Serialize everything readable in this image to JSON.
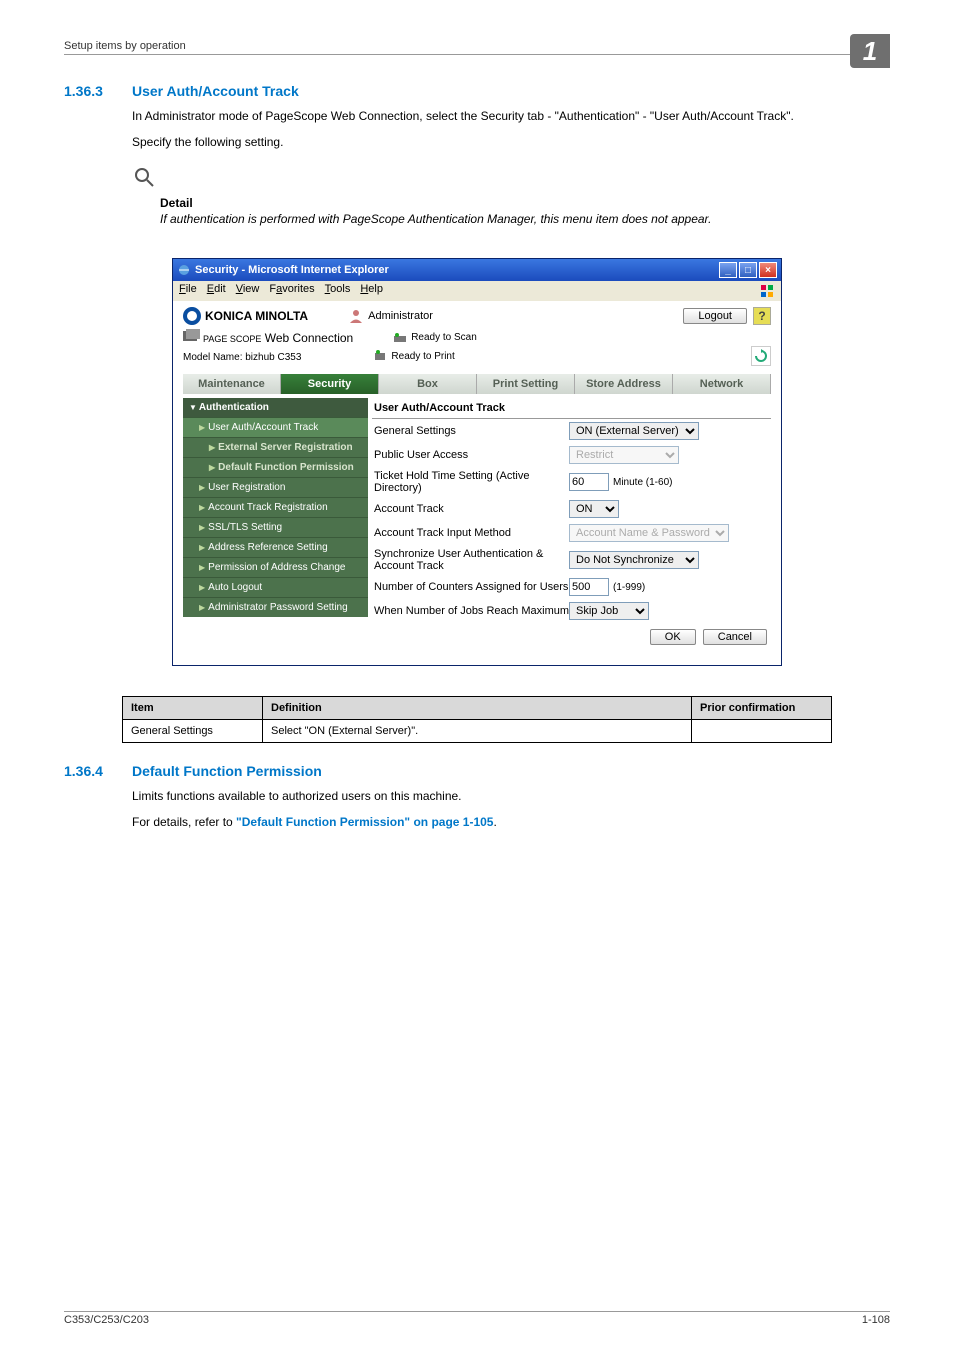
{
  "running_head": "Setup items by operation",
  "chapter_tab": "1",
  "section1": {
    "number": "1.36.3",
    "title": "User Auth/Account Track"
  },
  "intro1": "In Administrator mode of PageScope Web Connection, select the Security tab - \"Authentication\" - \"User Auth/Account Track\".",
  "intro2": "Specify the following setting.",
  "detail": {
    "label": "Detail",
    "text": "If authentication is performed with PageScope Authentication Manager, this menu item does not appear."
  },
  "browser": {
    "title": "Security - Microsoft Internet Explorer",
    "menus": [
      "File",
      "Edit",
      "View",
      "Favorites",
      "Tools",
      "Help"
    ]
  },
  "header": {
    "brand": "KONICA MINOLTA",
    "admin_label": "Administrator",
    "logout": "Logout",
    "product": "Web Connection",
    "product_prefix": "PAGE SCOPE",
    "status_scan": "Ready to Scan",
    "status_print": "Ready to Print",
    "model": "Model Name: bizhub C353"
  },
  "tabs": [
    "Maintenance",
    "Security",
    "Box",
    "Print Setting",
    "Store Address",
    "Network"
  ],
  "side": {
    "head": "Authentication",
    "items": [
      "User Auth/Account Track",
      "External Server Registration",
      "Default Function Permission",
      "User Registration",
      "Account Track Registration",
      "SSL/TLS Setting",
      "Address Reference Setting",
      "Permission of Address Change",
      "Auto Logout",
      "Administrator Password Setting"
    ]
  },
  "form": {
    "title": "User Auth/Account Track",
    "rows": {
      "general_settings": {
        "label": "General Settings",
        "value": "ON (External Server)"
      },
      "public_user": {
        "label": "Public User Access",
        "value": "Restrict"
      },
      "ticket": {
        "label": "Ticket Hold Time Setting (Active Directory)",
        "value": "60",
        "unit": "Minute (1-60)"
      },
      "account_track": {
        "label": "Account Track",
        "value": "ON"
      },
      "input_method": {
        "label": "Account Track Input Method",
        "value": "Account Name & Password"
      },
      "sync": {
        "label": "Synchronize User Authentication & Account Track",
        "value": "Do Not Synchronize"
      },
      "counters": {
        "label": "Number of Counters Assigned for Users",
        "value": "500",
        "unit": "(1-999)"
      },
      "maxjob": {
        "label": "When Number of Jobs Reach Maximum",
        "value": "Skip Job"
      }
    },
    "ok": "OK",
    "cancel": "Cancel"
  },
  "def_table": {
    "headers": {
      "item": "Item",
      "def": "Definition",
      "prior": "Prior confirmation"
    },
    "row1": {
      "item": "General Settings",
      "def": "Select \"ON (External Server)\".",
      "prior": ""
    }
  },
  "section2": {
    "number": "1.36.4",
    "title": "Default Function Permission"
  },
  "sec2_p1": "Limits functions available to authorized users on this machine.",
  "sec2_p2a": "For details, refer to ",
  "sec2_link": "\"Default Function Permission\" on page 1-105",
  "sec2_p2b": ".",
  "footer": {
    "left": "C353/C253/C203",
    "right": "1-108"
  }
}
